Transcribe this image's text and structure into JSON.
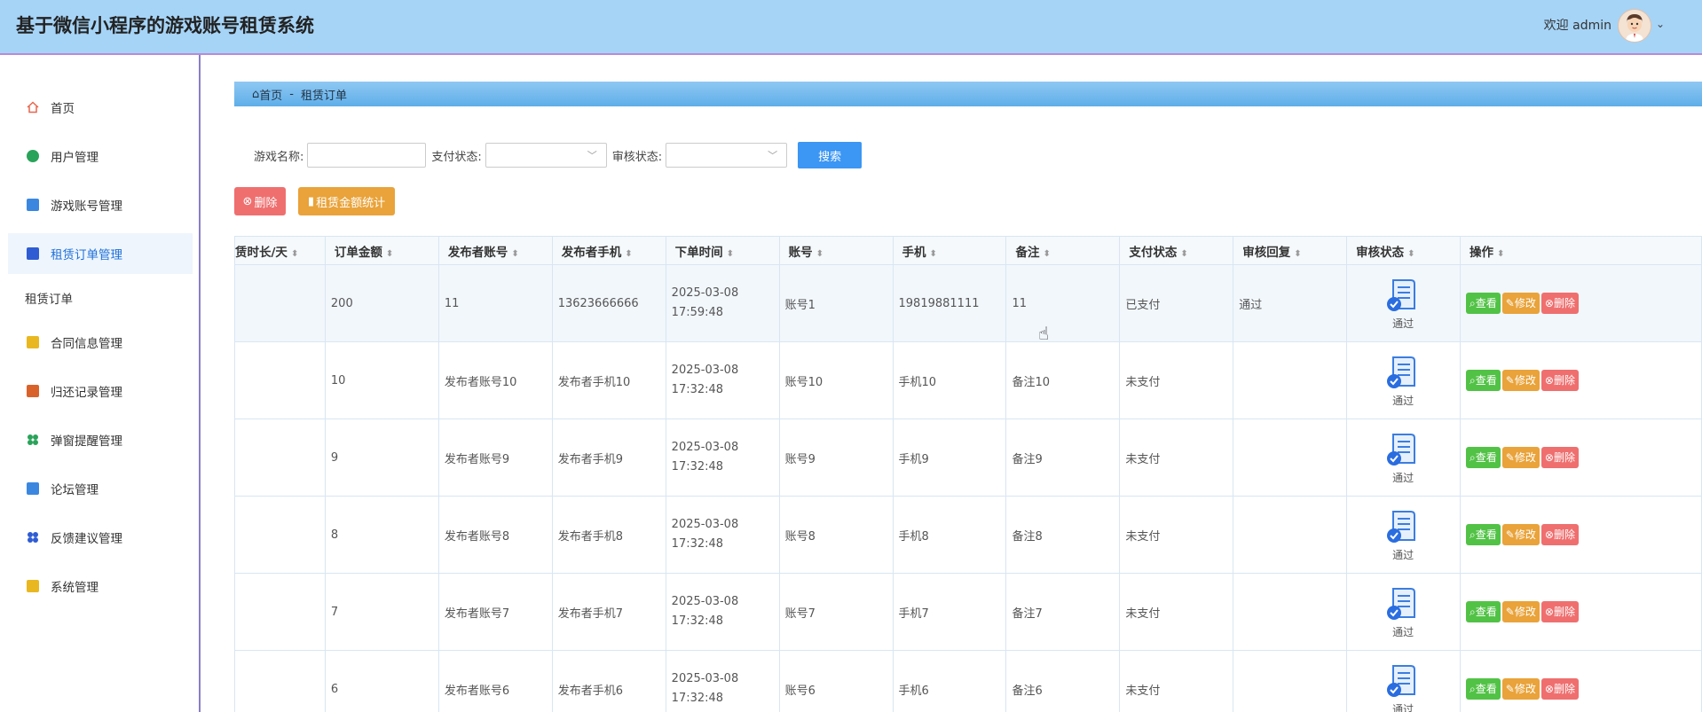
{
  "header": {
    "title": "基于微信小程序的游戏账号租赁系统",
    "welcome": "欢迎 admin",
    "avatar_icon": "user-avatar-icon"
  },
  "sidebar": {
    "items": [
      {
        "label": "首页",
        "icon": "home-icon",
        "color": "#e8664d"
      },
      {
        "label": "用户管理",
        "icon": "user-icon",
        "color": "#2aa35a"
      },
      {
        "label": "游戏账号管理",
        "icon": "gamepad-icon",
        "color": "#3b87e0"
      },
      {
        "label": "租赁订单管理",
        "icon": "order-icon",
        "color": "#2f5cd3"
      },
      {
        "label": "合同信息管理",
        "icon": "contract-icon",
        "color": "#e9b820"
      },
      {
        "label": "归还记录管理",
        "icon": "return-icon",
        "color": "#d9622b"
      },
      {
        "label": "弹窗提醒管理",
        "icon": "bell-icon",
        "color": "#2aa35a"
      },
      {
        "label": "论坛管理",
        "icon": "forum-icon",
        "color": "#3b87e0"
      },
      {
        "label": "反馈建议管理",
        "icon": "feedback-icon",
        "color": "#2f5cd3"
      },
      {
        "label": "系统管理",
        "icon": "settings-icon",
        "color": "#e9b820"
      }
    ],
    "submenu_label": "租赁订单",
    "active_color": "#1d6fd9"
  },
  "breadcrumb": {
    "home": "首页",
    "separator": "-",
    "current": "租赁订单"
  },
  "search": {
    "game_name_label": "游戏名称:",
    "pay_status_label": "支付状态:",
    "audit_status_label": "审核状态:",
    "search_button": "搜索"
  },
  "actions": {
    "delete_button": "删除",
    "stats_button": "租赁金额统计"
  },
  "table": {
    "headers": [
      "赁时长/天",
      "订单金额",
      "发布者账号",
      "发布者手机",
      "下单时间",
      "账号",
      "手机",
      "备注",
      "支付状态",
      "审核回复",
      "审核状态",
      "操作"
    ],
    "rows": [
      {
        "duration": "",
        "amount": "200",
        "pub_account": "11",
        "pub_phone": "13623666666",
        "time": "2025-03-08 17:59:48",
        "account": "账号1",
        "phone": "19819881111",
        "remark": "11",
        "pay": "已支付",
        "reply": "通过",
        "audit": "通过"
      },
      {
        "duration": "",
        "amount": "10",
        "pub_account": "发布者账号10",
        "pub_phone": "发布者手机10",
        "time": "2025-03-08 17:32:48",
        "account": "账号10",
        "phone": "手机10",
        "remark": "备注10",
        "pay": "未支付",
        "reply": "",
        "audit": "通过"
      },
      {
        "duration": "",
        "amount": "9",
        "pub_account": "发布者账号9",
        "pub_phone": "发布者手机9",
        "time": "2025-03-08 17:32:48",
        "account": "账号9",
        "phone": "手机9",
        "remark": "备注9",
        "pay": "未支付",
        "reply": "",
        "audit": "通过"
      },
      {
        "duration": "",
        "amount": "8",
        "pub_account": "发布者账号8",
        "pub_phone": "发布者手机8",
        "time": "2025-03-08 17:32:48",
        "account": "账号8",
        "phone": "手机8",
        "remark": "备注8",
        "pay": "未支付",
        "reply": "",
        "audit": "通过"
      },
      {
        "duration": "",
        "amount": "7",
        "pub_account": "发布者账号7",
        "pub_phone": "发布者手机7",
        "time": "2025-03-08 17:32:48",
        "account": "账号7",
        "phone": "手机7",
        "remark": "备注7",
        "pay": "未支付",
        "reply": "",
        "audit": "通过"
      },
      {
        "duration": "",
        "amount": "6",
        "pub_account": "发布者账号6",
        "pub_phone": "发布者手机6",
        "time": "2025-03-08 17:32:48",
        "account": "账号6",
        "phone": "手机6",
        "remark": "备注6",
        "pay": "未支付",
        "reply": "",
        "audit": "通过"
      }
    ],
    "op_labels": {
      "view": "查看",
      "edit": "修改",
      "delete": "删除"
    }
  }
}
